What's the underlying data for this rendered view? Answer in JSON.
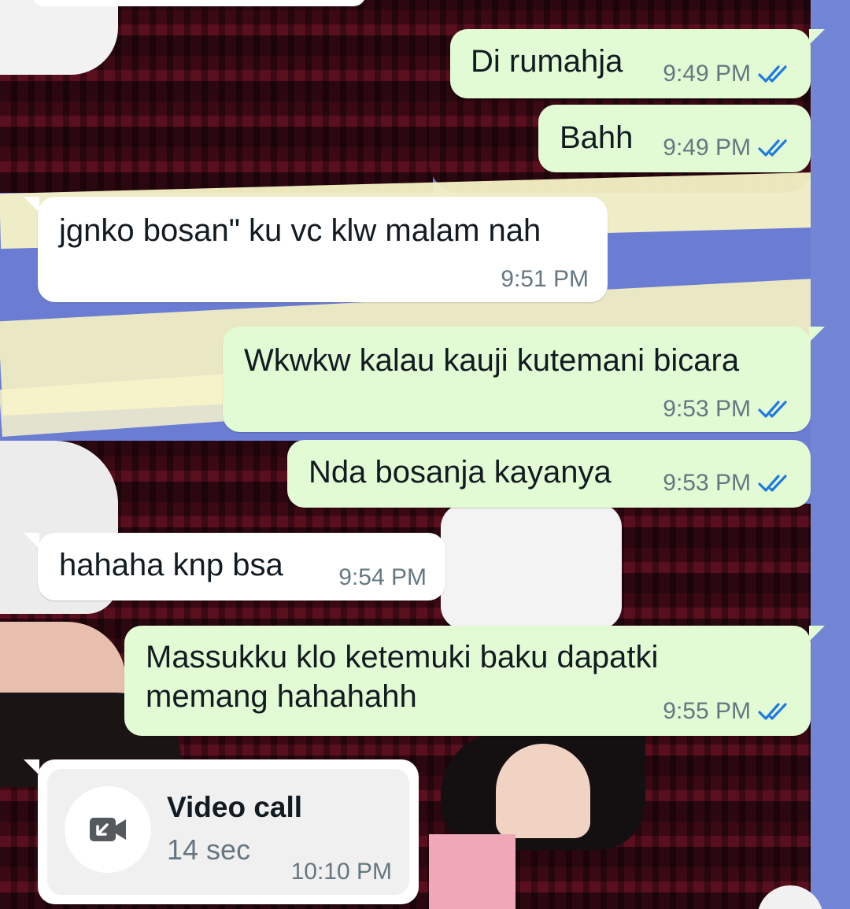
{
  "messages": [
    {
      "direction": "out",
      "text": "Di rumahja",
      "time": "9:49 PM",
      "status": "read"
    },
    {
      "direction": "out",
      "text": "Bahh",
      "time": "9:49 PM",
      "status": "read"
    },
    {
      "direction": "in",
      "text": "jgnko bosan\" ku vc klw malam nah",
      "time": "9:51 PM"
    },
    {
      "direction": "out",
      "text": "Wkwkw kalau kauji kutemani bicara",
      "time": "9:53 PM",
      "status": "read"
    },
    {
      "direction": "out",
      "text": "Nda bosanja kayanya",
      "time": "9:53 PM",
      "status": "read"
    },
    {
      "direction": "in",
      "text": "hahaha knp bsa",
      "time": "9:54 PM"
    },
    {
      "direction": "out",
      "text_lines": [
        "Massukku klo ketemuki baku dapatki",
        "memang hahahahh"
      ],
      "time": "9:55 PM",
      "status": "read"
    }
  ],
  "call": {
    "direction": "in",
    "title": "Video call",
    "duration": "14 sec",
    "time": "10:10 PM",
    "icon": "incoming-video-call-icon"
  },
  "colors": {
    "outgoing_bubble": "#e2fbd4",
    "incoming_bubble": "#ffffff",
    "read_ticks": "#1f7ae0",
    "meta_text": "#667781"
  }
}
